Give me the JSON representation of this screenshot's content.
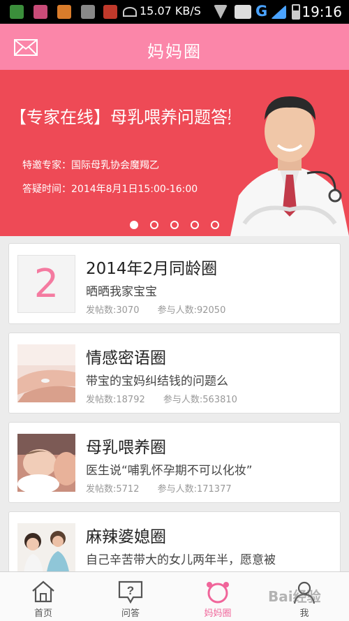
{
  "status_bar": {
    "network_speed": "15.07 KB/S",
    "network_type": "G",
    "time": "19:16"
  },
  "header": {
    "title": "妈妈圈",
    "mail_icon": "envelope-icon"
  },
  "banner": {
    "title": "【专家在线】母乳喂养问题答疑",
    "expert_line": "特邀专家：国际母乳协会魔羯乙",
    "time_line": "答疑时间：2014年8月1日15:00-16:00",
    "dots_count": 5,
    "active_dot": 1
  },
  "circles": [
    {
      "thumb_number": "2",
      "name": "2014年2月同龄圈",
      "desc": "晒晒我家宝宝",
      "posts": "发帖数:3070",
      "members": "参与人数:92050"
    },
    {
      "name": "情感密语圈",
      "desc": "带宝的宝妈纠结钱的问题么",
      "posts": "发帖数:18792",
      "members": "参与人数:563810"
    },
    {
      "name": "母乳喂养圈",
      "desc": "医生说“哺乳怀孕期不可以化妆”",
      "posts": "发帖数:5712",
      "members": "参与人数:171377"
    },
    {
      "name": "麻辣婆媳圈",
      "desc": "自己辛苦带大的女儿两年半，愿意被"
    }
  ],
  "bottom_nav": [
    {
      "label": "首页",
      "icon": "home-icon"
    },
    {
      "label": "问答",
      "icon": "question-icon"
    },
    {
      "label": "妈妈圈",
      "icon": "circle-icon",
      "active": true
    },
    {
      "label": "我",
      "icon": "profile-icon"
    }
  ],
  "watermark": "Bai经验",
  "colors": {
    "header_pink": "#fb86a9",
    "banner_red": "#ee4a56",
    "active_pink": "#f0659a"
  }
}
